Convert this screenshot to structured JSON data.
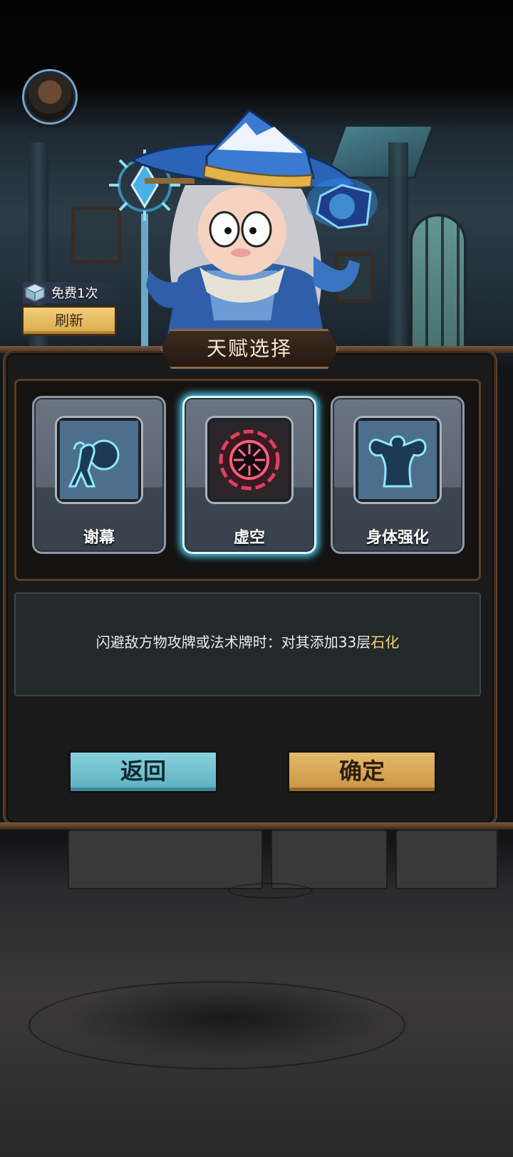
{
  "refresh": {
    "free_label": "免费1次",
    "button_label": "刷新"
  },
  "panel": {
    "title": "天赋选择"
  },
  "talents": [
    {
      "name": "谢幕",
      "icon": "hunched-figure-icon",
      "selected": false
    },
    {
      "name": "虚空",
      "icon": "void-eye-icon",
      "selected": true
    },
    {
      "name": "身体强化",
      "icon": "flexing-torso-icon",
      "selected": false
    }
  ],
  "description": {
    "text": "闪避敌方物攻牌或法术牌时：对其添加33层",
    "highlight": "石化",
    "highlight_color": "#f3d27a"
  },
  "buttons": {
    "back_label": "返回",
    "confirm_label": "确定"
  },
  "colors": {
    "back_button": "#6cbccc",
    "confirm_button": "#d6a655",
    "selected_glow": "#4cc9ea"
  }
}
